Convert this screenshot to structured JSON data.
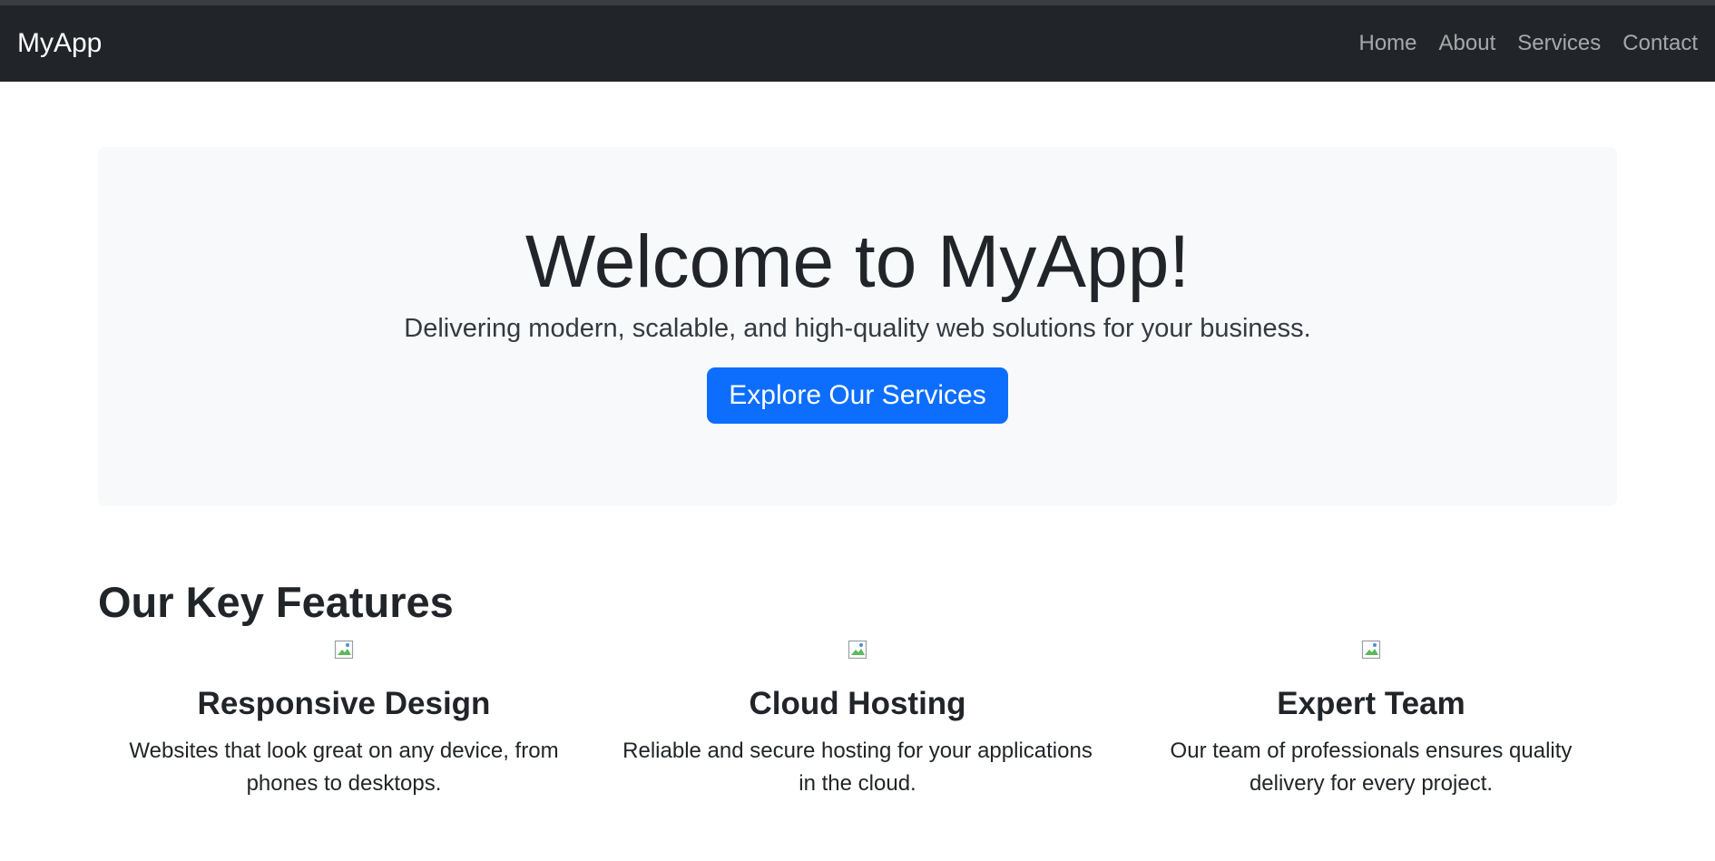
{
  "navbar": {
    "brand": "MyApp",
    "links": [
      {
        "label": "Home"
      },
      {
        "label": "About"
      },
      {
        "label": "Services"
      },
      {
        "label": "Contact"
      }
    ]
  },
  "hero": {
    "title": "Welcome to MyApp!",
    "subtitle": "Delivering modern, scalable, and high-quality web solutions for your business.",
    "button_label": "Explore Our Services"
  },
  "features": {
    "heading": "Our Key Features",
    "items": [
      {
        "icon": "broken-image-icon",
        "title": "Responsive Design",
        "text": "Websites that look great on any device, from phones to desktops."
      },
      {
        "icon": "broken-image-icon",
        "title": "Cloud Hosting",
        "text": "Reliable and secure hosting for your applications in the cloud."
      },
      {
        "icon": "broken-image-icon",
        "title": "Expert Team",
        "text": "Our team of professionals ensures quality delivery for every project."
      }
    ]
  },
  "colors": {
    "navbar_bg": "#212529",
    "hero_bg": "#f8f9fa",
    "primary_button": "#0d6efd"
  }
}
